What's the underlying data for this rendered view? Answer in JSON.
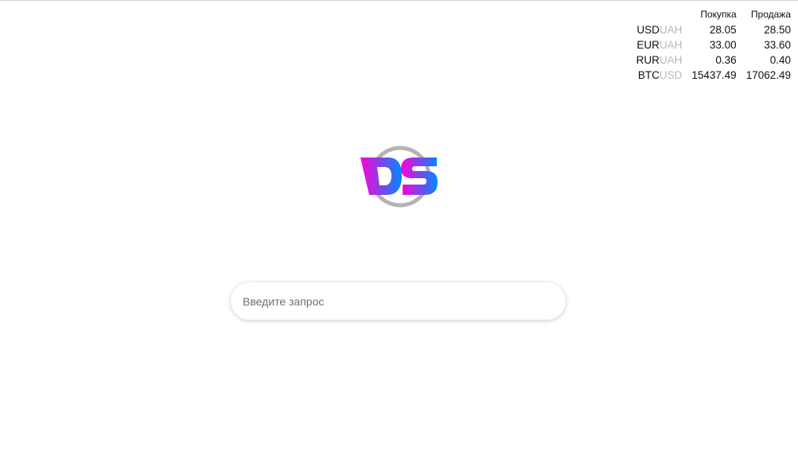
{
  "rates": {
    "headers": {
      "buy": "Покупка",
      "sell": "Продажа"
    },
    "rows": [
      {
        "base": "USD",
        "quote": "UAH",
        "buy": "28.05",
        "sell": "28.50"
      },
      {
        "base": "EUR",
        "quote": "UAH",
        "buy": "33.00",
        "sell": "33.60"
      },
      {
        "base": "RUR",
        "quote": "UAH",
        "buy": "0.36",
        "sell": "0.40"
      },
      {
        "base": "BTC",
        "quote": "USD",
        "buy": "15437.49",
        "sell": "17062.49"
      }
    ]
  },
  "logo": {
    "text": "DS",
    "ring_color": "#b3b3b3",
    "gradient": [
      "#ff00d4",
      "#0088ff"
    ]
  },
  "search": {
    "placeholder": "Введите запрос"
  }
}
